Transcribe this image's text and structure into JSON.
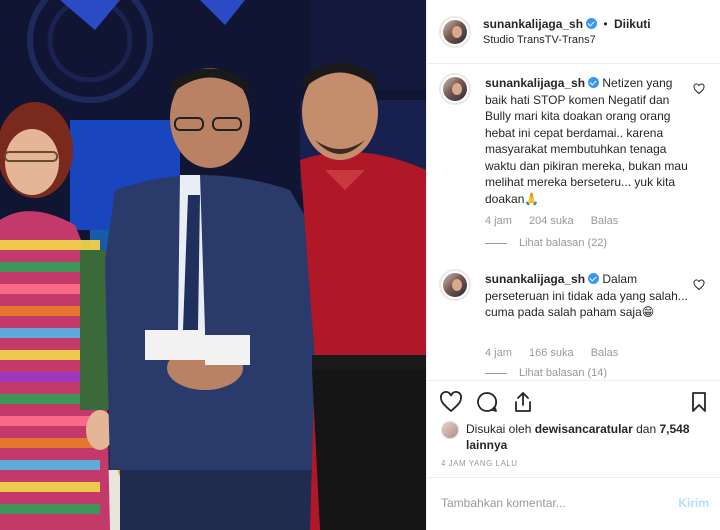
{
  "post": {
    "username": "sunankalijaga_sh",
    "follow_dot": "•",
    "follow_status": "Diikuti",
    "location": "Studio TransTV-Trans7"
  },
  "comments": [
    {
      "username": "sunankalijaga_sh",
      "text": "Netizen yang baik hati STOP komen Negatif dan Bully mari kita doakan orang orang hebat ini cepat berdamai.. karena masyarakat membutuhkan tenaga waktu dan pikiran mereka, bukan mau melihat mereka berseteru... yuk kita doakan🙏",
      "time": "4 jam",
      "likes": "204 suka",
      "reply": "Balas",
      "view_replies": "Lihat balasan (22)"
    },
    {
      "username": "sunankalijaga_sh",
      "text": "Dalam perseteruan ini tidak ada yang salah... cuma pada salah paham saja😁",
      "time": "4 jam",
      "likes": "166 suka",
      "reply": "Balas",
      "view_replies": "Lihat balasan (14)"
    }
  ],
  "likes": {
    "prefix": "Disukai oleh",
    "user": "dewisancaratular",
    "middle": "dan",
    "others": "7,548 lainnya"
  },
  "time_ago": "4 JAM YANG LALU",
  "add_comment": {
    "placeholder": "Tambahkan komentar...",
    "send_label": "Kirim"
  },
  "colors": {
    "verified": "#3897f0",
    "send_disabled": "#b2dffc",
    "muted": "#999999"
  },
  "icons": [
    "verified-icon",
    "heart-icon",
    "comment-icon",
    "share-icon",
    "bookmark-icon"
  ]
}
